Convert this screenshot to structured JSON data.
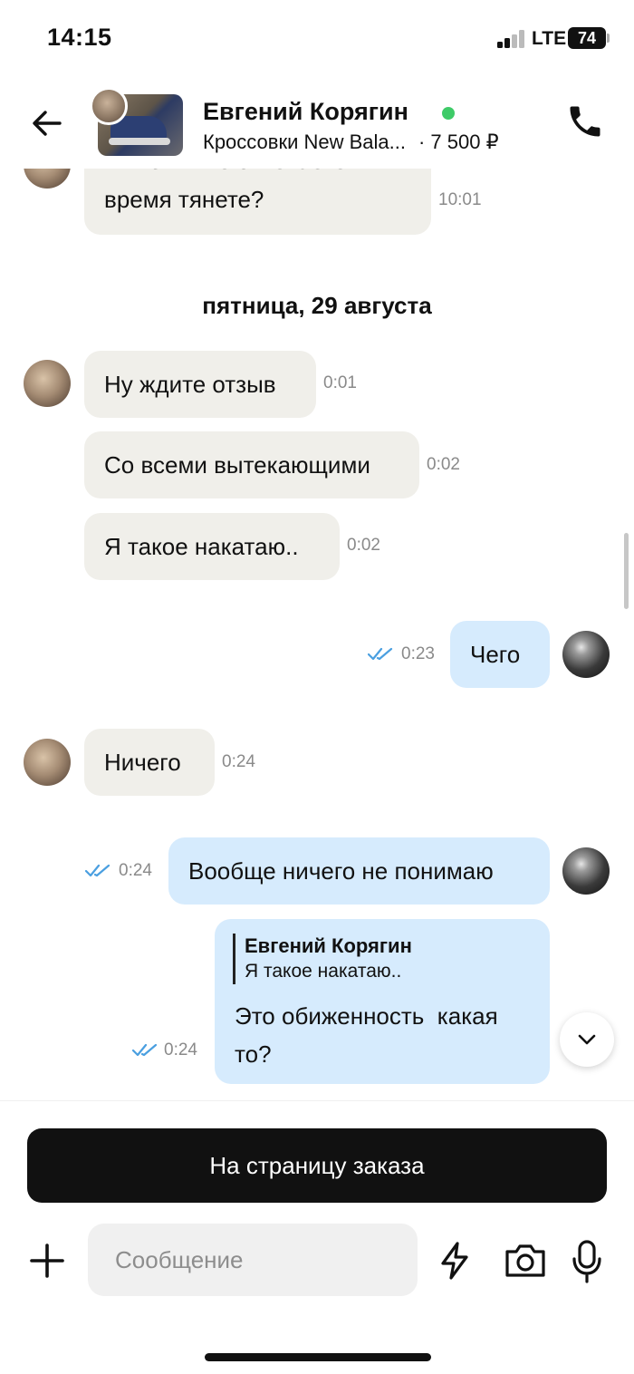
{
  "status_bar": {
    "time": "14:15",
    "network": "LTE",
    "battery": "74"
  },
  "header": {
    "contact_name": "Евгений Корягин",
    "product_title": "Кроссовки New Bala...",
    "product_price": "· 7 500 ₽",
    "online": true,
    "icons": {
      "back": "arrow-left-icon",
      "call": "phone-icon"
    }
  },
  "messages": {
    "partial_text": "А что вы не отвечаете и",
    "partial_text_2": "время тянете?",
    "partial_time": "10:01",
    "date_separator": "пятница, 29 августа",
    "m1_text": "Ну ждите отзыв",
    "m1_time": "0:01",
    "m2_text": "Со всеми вытекающими",
    "m2_time": "0:02",
    "m3_text": "Я такое накатаю..",
    "m3_time": "0:02",
    "m4_text": "Чего",
    "m4_time": "0:23",
    "m5_text": "Ничего",
    "m5_time": "0:24",
    "m6_text": "Вообще ничего не понимаю",
    "m6_time": "0:24",
    "m7_reply_author": "Евгений Корягин",
    "m7_reply_text": "Я такое накатаю..",
    "m7_text_line1": "Это обиженность  какая",
    "m7_text_line2": "то?",
    "m7_time": "0:24"
  },
  "bottom": {
    "order_button": "На страницу заказа",
    "input_placeholder": "Сообщение",
    "icons": {
      "add": "plus-icon",
      "quick": "lightning-icon",
      "camera": "camera-icon",
      "voice": "microphone-icon"
    }
  },
  "colors": {
    "incoming_bubble": "#f0efea",
    "outgoing_bubble": "#d6ebfd",
    "read_ticks": "#4a9fe0",
    "online": "#3ecb68"
  }
}
